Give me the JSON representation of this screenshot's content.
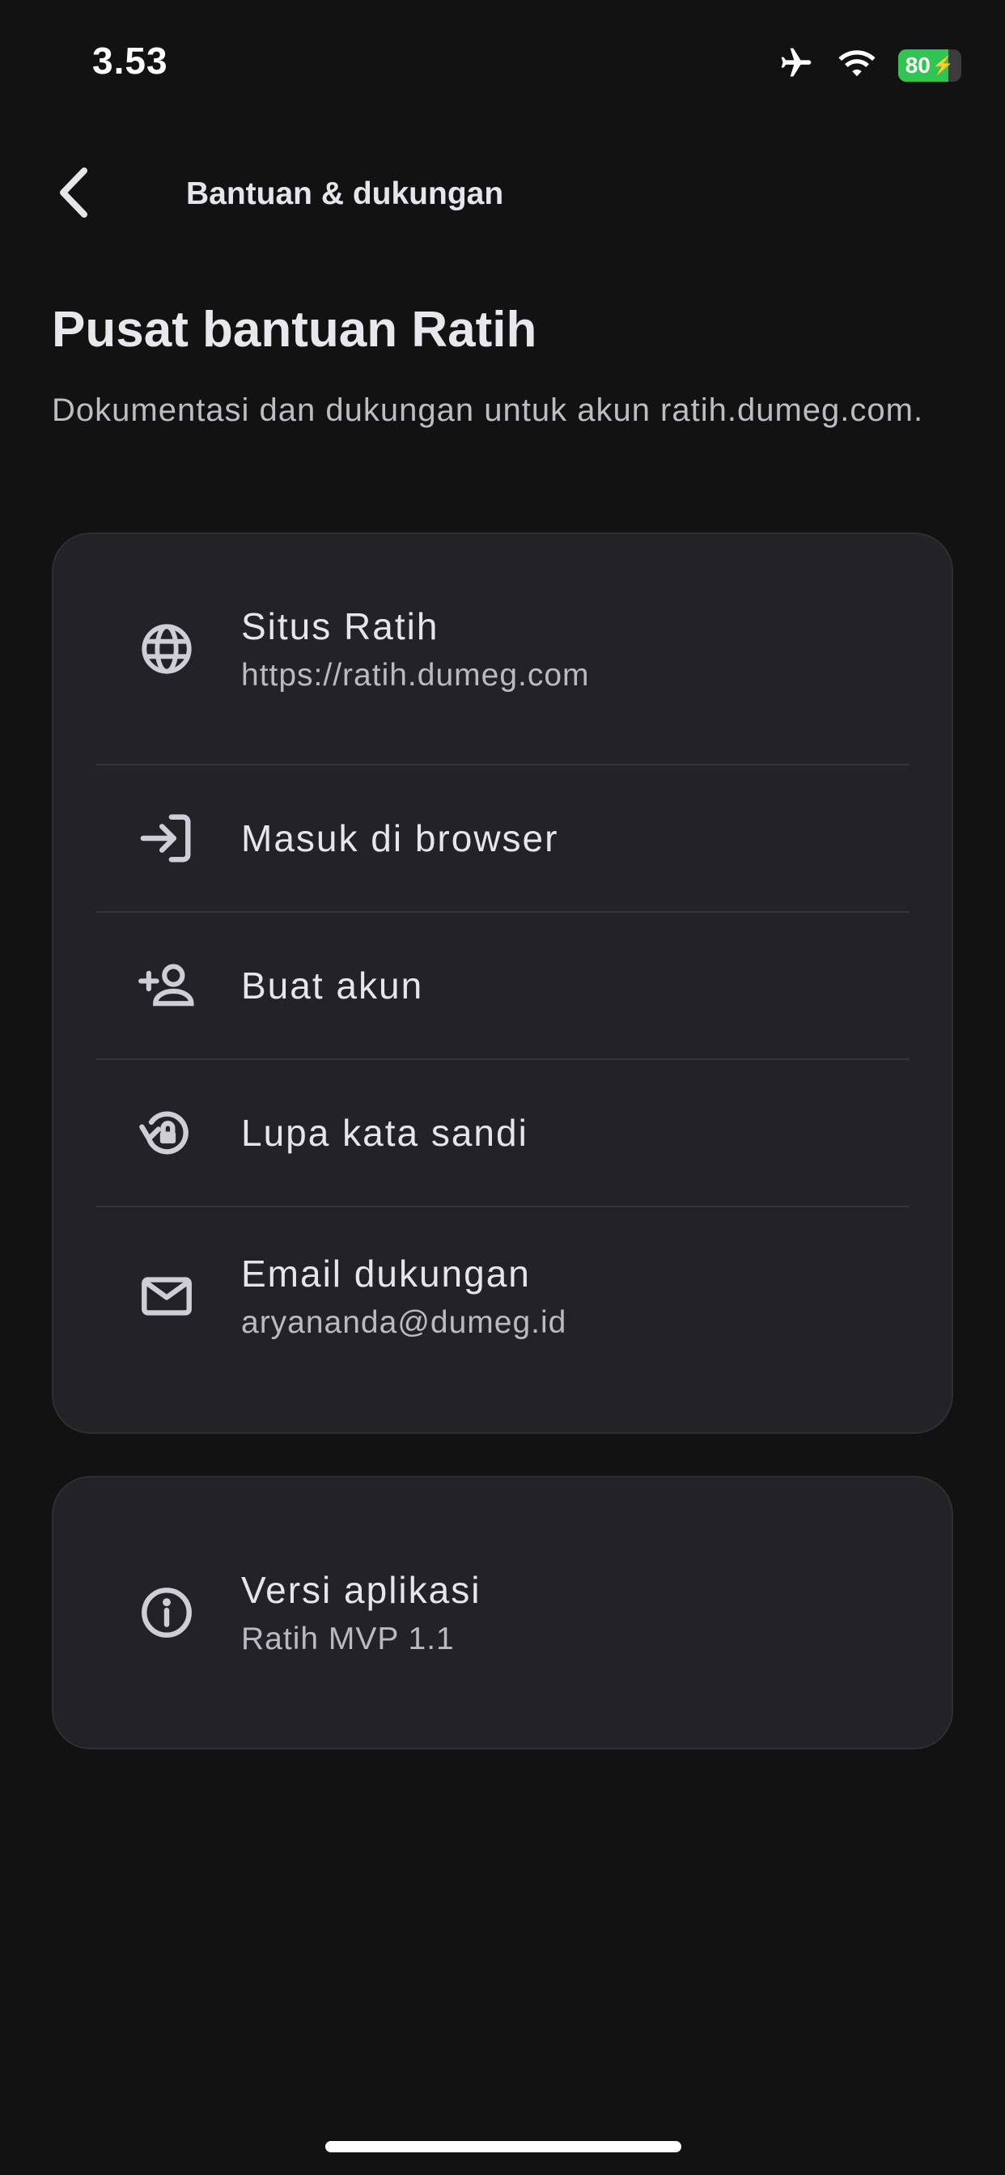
{
  "status_bar": {
    "time": "3.53",
    "battery_level": "80",
    "battery_fraction": 0.8,
    "battery_color": "#30c552",
    "icons": [
      "airplane-icon",
      "wifi-icon",
      "battery-icon"
    ]
  },
  "topbar": {
    "back_icon": "chevron-left-icon",
    "title": "Bantuan & dukungan"
  },
  "header": {
    "title": "Pusat bantuan Ratih",
    "description": "Dokumentasi dan dukungan untuk akun ratih.dumeg.com."
  },
  "links": [
    {
      "icon": "globe-icon",
      "title": "Situs Ratih",
      "subtitle": "https://ratih.dumeg.com"
    },
    {
      "icon": "login-icon",
      "title": "Masuk di browser",
      "subtitle": ""
    },
    {
      "icon": "person-add-icon",
      "title": "Buat akun",
      "subtitle": ""
    },
    {
      "icon": "lock-reset-icon",
      "title": "Lupa kata sandi",
      "subtitle": ""
    },
    {
      "icon": "mail-icon",
      "title": "Email dukungan",
      "subtitle": "aryananda@dumeg.id"
    }
  ],
  "version": {
    "icon": "info-icon",
    "title": "Versi aplikasi",
    "subtitle": "Ratih MVP 1.1"
  },
  "colors": {
    "background": "#121212",
    "card": "#232327",
    "text": "#e6e5ec"
  }
}
